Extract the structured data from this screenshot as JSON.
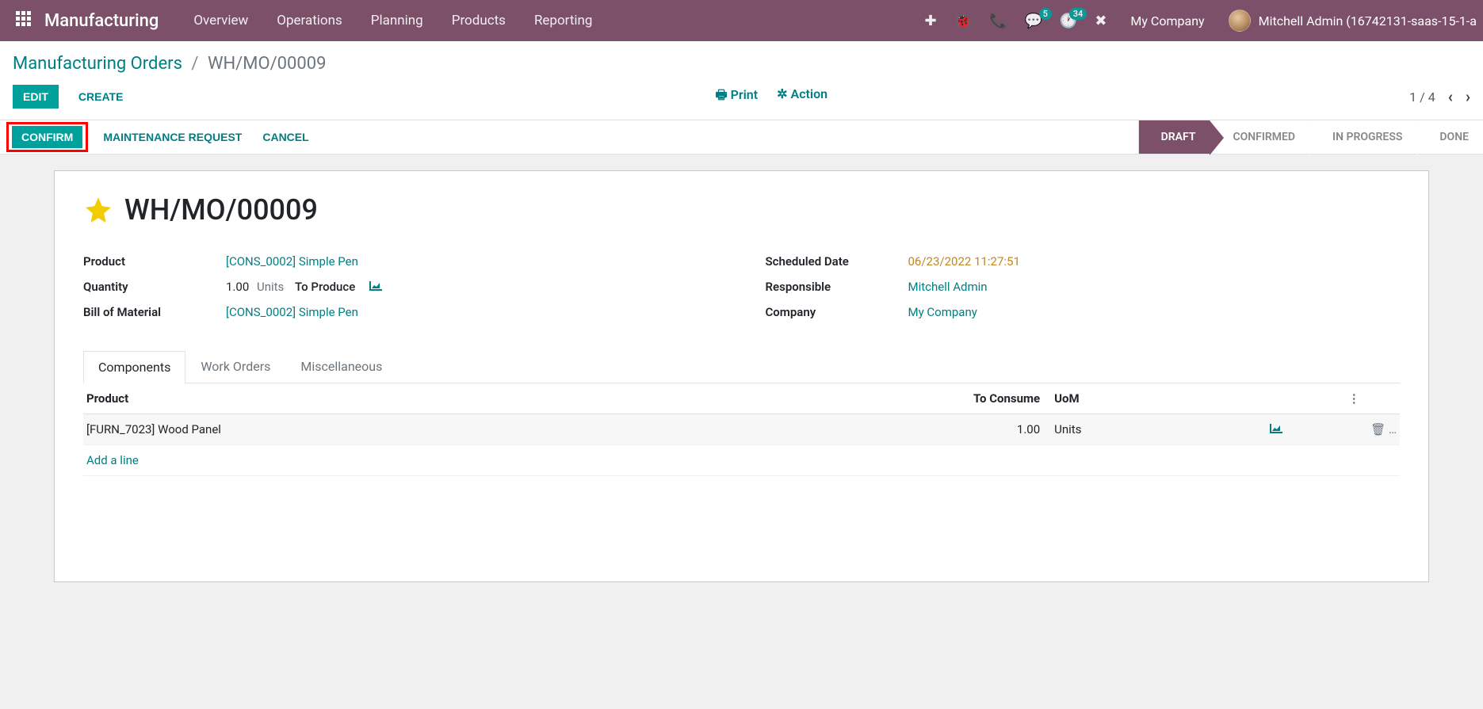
{
  "topnav": {
    "app_title": "Manufacturing",
    "items": [
      "Overview",
      "Operations",
      "Planning",
      "Products",
      "Reporting"
    ],
    "messages_badge": "5",
    "activities_badge": "34",
    "company": "My Company",
    "user": "Mitchell Admin (16742131-saas-15-1-a"
  },
  "breadcrumb": {
    "parent": "Manufacturing Orders",
    "current": "WH/MO/00009"
  },
  "control": {
    "edit": "Edit",
    "create": "Create",
    "print": "Print",
    "action": "Action",
    "pager": "1 / 4"
  },
  "statusbar": {
    "confirm": "Confirm",
    "maintenance": "Maintenance Request",
    "cancel": "Cancel",
    "steps": [
      "Draft",
      "Confirmed",
      "In Progress",
      "Done"
    ],
    "active_index": 0
  },
  "sheet": {
    "title": "WH/MO/00009",
    "left": {
      "product_label": "Product",
      "product_value": "[CONS_0002] Simple Pen",
      "quantity_label": "Quantity",
      "quantity_value": "1.00",
      "quantity_unit": "Units",
      "quantity_to_produce": "To Produce",
      "bom_label": "Bill of Material",
      "bom_value": "[CONS_0002] Simple Pen"
    },
    "right": {
      "scheduled_label": "Scheduled Date",
      "scheduled_value": "06/23/2022 11:27:51",
      "responsible_label": "Responsible",
      "responsible_value": "Mitchell Admin",
      "company_label": "Company",
      "company_value": "My Company"
    }
  },
  "tabs": {
    "components": "Components",
    "work_orders": "Work Orders",
    "miscellaneous": "Miscellaneous"
  },
  "components_table": {
    "headers": {
      "product": "Product",
      "to_consume": "To Consume",
      "uom": "UoM"
    },
    "rows": [
      {
        "product": "[FURN_7023] Wood Panel",
        "to_consume": "1.00",
        "uom": "Units"
      }
    ],
    "add_line": "Add a line"
  }
}
